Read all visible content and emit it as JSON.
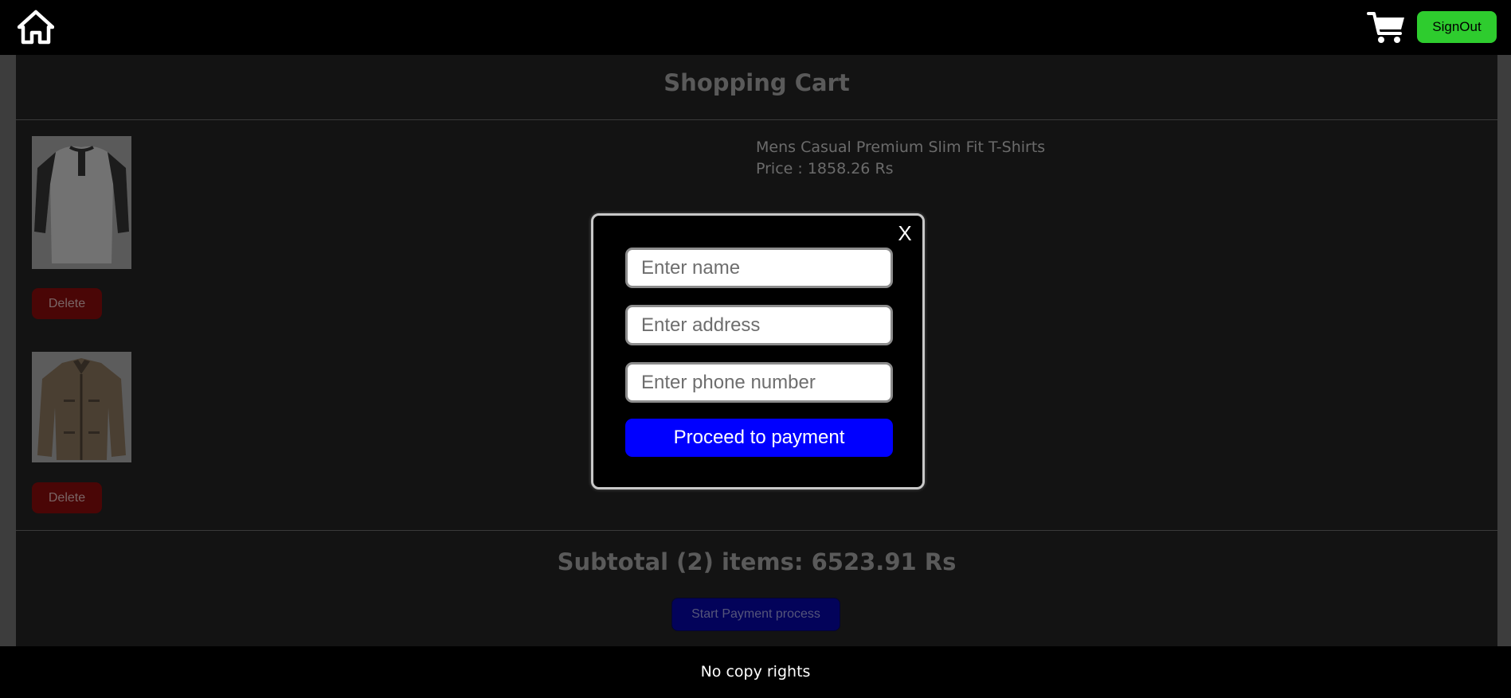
{
  "navbar": {
    "home_icon": "home-icon",
    "cart_icon": "shopping-cart-icon",
    "signout_label": "SignOut"
  },
  "cart": {
    "title": "Shopping Cart",
    "items": [
      {
        "name": "Mens Casual Premium Slim Fit T-Shirts",
        "price": "Price : 1858.26 Rs",
        "image": "raglan-henley-tshirt",
        "delete_label": "Delete"
      },
      {
        "name": "",
        "price": "",
        "image": "khaki-jacket",
        "delete_label": "Delete"
      }
    ],
    "subtotal": "Subtotal (2) items: 6523.91 Rs",
    "start_payment_label": "Start Payment process"
  },
  "modal": {
    "close_label": "X",
    "name_placeholder": "Enter name",
    "address_placeholder": "Enter address",
    "phone_placeholder": "Enter phone number",
    "proceed_label": "Proceed to payment"
  },
  "footer": {
    "text": "No copy rights"
  },
  "colors": {
    "navbar_bg": "#000000",
    "signout_green": "#2ecc2e",
    "proceed_blue": "#0000ff",
    "delete_red_dimmed": "#4a0606"
  }
}
